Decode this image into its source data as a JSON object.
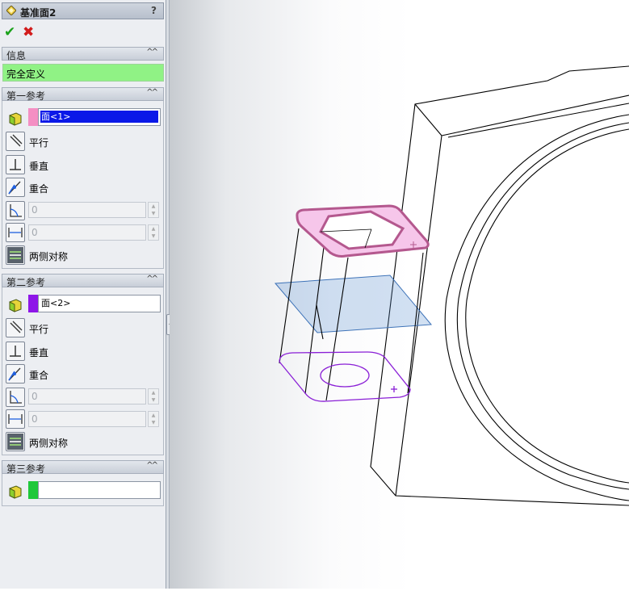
{
  "panel": {
    "title": "基准面2",
    "help": "?",
    "ok_icon": "✔",
    "cancel_icon": "✖",
    "info": {
      "header": "信息",
      "status": "完全定义"
    },
    "ref1": {
      "header": "第一参考",
      "selection": "面<1>",
      "swatch_color": "#f48fc3",
      "parallel": "平行",
      "perpendicular": "垂直",
      "coincident": "重合",
      "angle_value": "0",
      "distance_value": "0",
      "symmetric": "两侧对称"
    },
    "ref2": {
      "header": "第二参考",
      "selection": "面<2>",
      "swatch_color": "#8e16e8",
      "parallel": "平行",
      "perpendicular": "垂直",
      "coincident": "重合",
      "angle_value": "0",
      "distance_value": "0",
      "symmetric": "两侧对称"
    },
    "ref3": {
      "header": "第三参考",
      "selection": "",
      "swatch_color": "#1fc83a"
    }
  },
  "colors": {
    "status_green": "#90f285",
    "selected_face_fill": "#f6c6ea",
    "selected_face_edge": "#b4588e",
    "second_face_edge": "#8a1fd6",
    "preview_plane": "#5b8fd0"
  }
}
